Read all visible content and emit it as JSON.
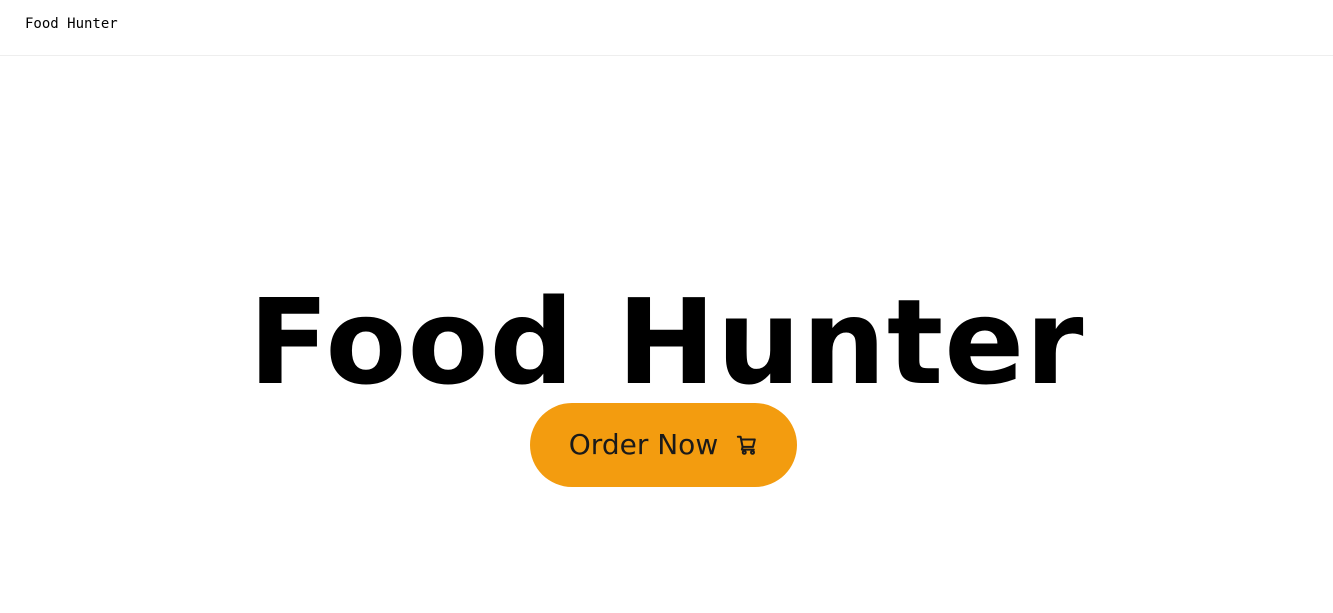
{
  "navbar": {
    "brand": "Food Hunter"
  },
  "hero": {
    "title": "Food Hunter",
    "cta_label": "Order Now",
    "cta_icon": "cart-icon",
    "cta_color": "#f39c0f"
  }
}
